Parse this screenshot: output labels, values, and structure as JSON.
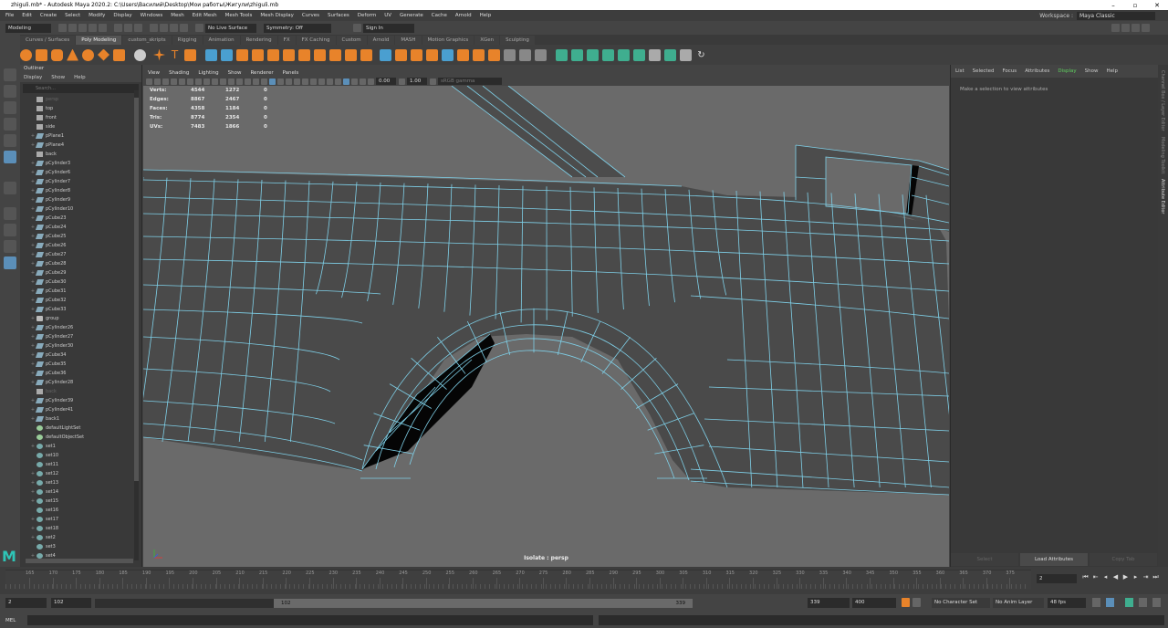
{
  "window": {
    "title": "zhiguli.mb* - Autodesk Maya 2020.2: C:\\Users\\Василий\\Desktop\\Мои работы\\Жигули\\zhiguli.mb",
    "buttons": [
      "–",
      "▫",
      "✕"
    ]
  },
  "menubar": {
    "items": [
      "File",
      "Edit",
      "Create",
      "Select",
      "Modify",
      "Display",
      "Windows",
      "Mesh",
      "Edit Mesh",
      "Mesh Tools",
      "Mesh Display",
      "Curves",
      "Surfaces",
      "Deform",
      "UV",
      "Generate",
      "Cache",
      "Arnold",
      "Help"
    ],
    "workspace_label": "Workspace :",
    "workspace_value": "Maya Classic"
  },
  "statusline": {
    "mode": "Modeling",
    "live_surface": "No Live Surface",
    "symmetry": "Symmetry: Off",
    "signin": "Sign In"
  },
  "shelf": {
    "tabs": [
      "Curves / Surfaces",
      "Poly Modeling",
      "custom_skripts",
      "Rigging",
      "Animation",
      "Rendering",
      "FX",
      "FX Caching",
      "Custom",
      "Arnold",
      "MASH",
      "Motion Graphics",
      "XGen",
      "Sculpting"
    ],
    "active_tab": "Poly Modeling",
    "accent_orange": "#e8832a",
    "accent_green": "#3fae8f"
  },
  "outliner": {
    "title": "Outliner",
    "menu": [
      "Display",
      "Show",
      "Help"
    ],
    "search_placeholder": "Search...",
    "items": [
      {
        "label": "persp",
        "icon": "camera",
        "dim": true,
        "exp": ""
      },
      {
        "label": "top",
        "icon": "camera",
        "dim": false,
        "exp": ""
      },
      {
        "label": "front",
        "icon": "camera",
        "dim": false,
        "exp": ""
      },
      {
        "label": "side",
        "icon": "camera",
        "dim": false,
        "exp": ""
      },
      {
        "label": "pPlane1",
        "icon": "mesh",
        "dim": false,
        "exp": "+"
      },
      {
        "label": "pPlane4",
        "icon": "mesh",
        "dim": false,
        "exp": "+"
      },
      {
        "label": "back",
        "icon": "camera",
        "dim": false,
        "exp": ""
      },
      {
        "label": "pCylinder3",
        "icon": "mesh",
        "dim": false,
        "exp": "+"
      },
      {
        "label": "pCylinder6",
        "icon": "mesh",
        "dim": false,
        "exp": "+"
      },
      {
        "label": "pCylinder7",
        "icon": "mesh",
        "dim": false,
        "exp": "+"
      },
      {
        "label": "pCylinder8",
        "icon": "mesh",
        "dim": false,
        "exp": "+"
      },
      {
        "label": "pCylinder9",
        "icon": "mesh",
        "dim": false,
        "exp": "+"
      },
      {
        "label": "pCylinder10",
        "icon": "mesh",
        "dim": false,
        "exp": "+"
      },
      {
        "label": "pCube23",
        "icon": "mesh",
        "dim": false,
        "exp": "+"
      },
      {
        "label": "pCube24",
        "icon": "mesh",
        "dim": false,
        "exp": "+"
      },
      {
        "label": "pCube25",
        "icon": "mesh",
        "dim": false,
        "exp": "+"
      },
      {
        "label": "pCube26",
        "icon": "mesh",
        "dim": false,
        "exp": "+"
      },
      {
        "label": "pCube27",
        "icon": "mesh",
        "dim": false,
        "exp": "+"
      },
      {
        "label": "pCube28",
        "icon": "mesh",
        "dim": false,
        "exp": "+"
      },
      {
        "label": "pCube29",
        "icon": "mesh",
        "dim": false,
        "exp": "+"
      },
      {
        "label": "pCube30",
        "icon": "mesh",
        "dim": false,
        "exp": "+"
      },
      {
        "label": "pCube31",
        "icon": "mesh",
        "dim": false,
        "exp": "+"
      },
      {
        "label": "pCube32",
        "icon": "mesh",
        "dim": false,
        "exp": "+"
      },
      {
        "label": "pCube33",
        "icon": "mesh",
        "dim": false,
        "exp": "+"
      },
      {
        "label": "group",
        "icon": "group",
        "dim": false,
        "exp": "+"
      },
      {
        "label": "pCylinder26",
        "icon": "mesh",
        "dim": false,
        "exp": "+"
      },
      {
        "label": "pCylinder27",
        "icon": "mesh",
        "dim": false,
        "exp": "+"
      },
      {
        "label": "pCylinder30",
        "icon": "mesh",
        "dim": false,
        "exp": "+"
      },
      {
        "label": "pCube34",
        "icon": "mesh",
        "dim": false,
        "exp": "+"
      },
      {
        "label": "pCube35",
        "icon": "mesh",
        "dim": false,
        "exp": "+"
      },
      {
        "label": "pCube36",
        "icon": "mesh",
        "dim": false,
        "exp": "+"
      },
      {
        "label": "pCylinder28",
        "icon": "mesh",
        "dim": false,
        "exp": "+"
      },
      {
        "label": "back",
        "icon": "camera",
        "dim": true,
        "exp": ""
      },
      {
        "label": "pCylinder39",
        "icon": "mesh",
        "dim": false,
        "exp": "+"
      },
      {
        "label": "pCylinder41",
        "icon": "mesh",
        "dim": false,
        "exp": "+"
      },
      {
        "label": "back1",
        "icon": "mesh",
        "dim": false,
        "exp": "+"
      },
      {
        "label": "defaultLightSet",
        "icon": "light",
        "dim": false,
        "exp": ""
      },
      {
        "label": "defaultObjectSet",
        "icon": "light",
        "dim": false,
        "exp": ""
      },
      {
        "label": "set1",
        "icon": "set",
        "dim": false,
        "exp": "+"
      },
      {
        "label": "set10",
        "icon": "set",
        "dim": false,
        "exp": ""
      },
      {
        "label": "set11",
        "icon": "set",
        "dim": false,
        "exp": ""
      },
      {
        "label": "set12",
        "icon": "set",
        "dim": false,
        "exp": "+"
      },
      {
        "label": "set13",
        "icon": "set",
        "dim": false,
        "exp": "+"
      },
      {
        "label": "set14",
        "icon": "set",
        "dim": false,
        "exp": "+"
      },
      {
        "label": "set15",
        "icon": "set",
        "dim": false,
        "exp": "+"
      },
      {
        "label": "set16",
        "icon": "set",
        "dim": false,
        "exp": ""
      },
      {
        "label": "set17",
        "icon": "set",
        "dim": false,
        "exp": "+"
      },
      {
        "label": "set18",
        "icon": "set",
        "dim": false,
        "exp": "+"
      },
      {
        "label": "set2",
        "icon": "set",
        "dim": false,
        "exp": "+"
      },
      {
        "label": "set3",
        "icon": "set",
        "dim": false,
        "exp": ""
      },
      {
        "label": "set4",
        "icon": "set",
        "dim": false,
        "exp": "+"
      }
    ]
  },
  "viewport": {
    "menu": [
      "View",
      "Shading",
      "Lighting",
      "Show",
      "Renderer",
      "Panels"
    ],
    "num_field_1": "0.00",
    "num_field_2": "1.00",
    "colorspace": "sRGB gamma",
    "camera_label": "Isolate : persp",
    "wire_color": "#7fd0e8",
    "hud": [
      {
        "k": "Verts:",
        "v1": "4544",
        "v2": "1272",
        "v3": "0"
      },
      {
        "k": "Edges:",
        "v1": "8867",
        "v2": "2467",
        "v3": "0"
      },
      {
        "k": "Faces:",
        "v1": "4358",
        "v2": "1184",
        "v3": "0"
      },
      {
        "k": "Tris:",
        "v1": "8774",
        "v2": "2354",
        "v3": "0"
      },
      {
        "k": "UVs:",
        "v1": "7483",
        "v2": "1866",
        "v3": "0"
      }
    ]
  },
  "attribute_editor": {
    "menu": [
      "List",
      "Selected",
      "Focus",
      "Attributes",
      "Display",
      "Show",
      "Help"
    ],
    "highlight": "Display",
    "message": "Make a selection to view attributes",
    "buttons": [
      "Select",
      "Load Attributes",
      "Copy Tab"
    ],
    "side_tabs": [
      "Channel Box / Layer Editor",
      "Modeling Toolkit",
      "Attribute Editor"
    ]
  },
  "timeslider": {
    "ticks": [
      "165",
      "170",
      "175",
      "180",
      "185",
      "190",
      "195",
      "200",
      "205",
      "210",
      "215",
      "220",
      "225",
      "230",
      "235",
      "240",
      "245",
      "250",
      "255",
      "260",
      "265",
      "270",
      "275",
      "280",
      "285",
      "290",
      "295",
      "300",
      "305",
      "310",
      "315",
      "320",
      "325",
      "330",
      "335",
      "340",
      "345",
      "350",
      "355",
      "360",
      "365",
      "370",
      "375"
    ],
    "current_frame": "2"
  },
  "range": {
    "start": "2",
    "range_start": "102",
    "slider_start": "102",
    "slider_end": "339",
    "range_end": "339",
    "end": "400",
    "character_set": "No Character Set",
    "anim_layer": "No Anim Layer",
    "fps": "48 fps"
  },
  "cmdline": {
    "label": "MEL"
  }
}
